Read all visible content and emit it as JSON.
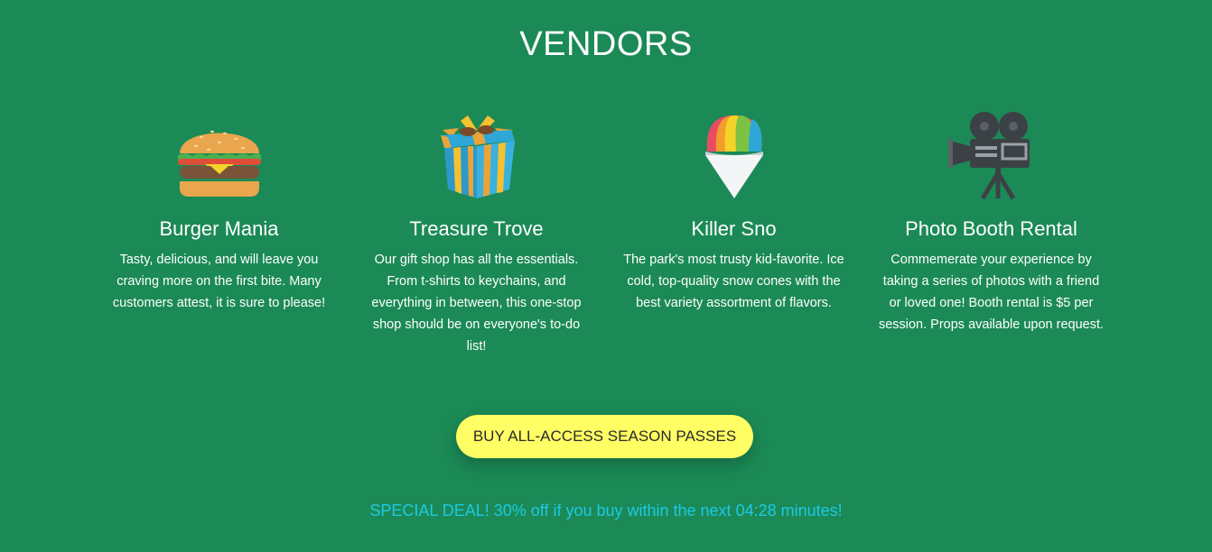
{
  "header": {
    "title": "VENDORS"
  },
  "vendors": [
    {
      "icon": "burger-icon",
      "name": "Burger Mania",
      "description": "Tasty, delicious, and will leave you craving more on the first bite. Many customers attest, it is sure to please!"
    },
    {
      "icon": "gift-box-icon",
      "name": "Treasure Trove",
      "description": "Our gift shop has all the essentials. From t-shirts to keychains, and everything in between, this one-stop shop should be on everyone's to-do list!"
    },
    {
      "icon": "snow-cone-icon",
      "name": "Killer Sno",
      "description": "The park's most trusty kid-favorite. Ice cold, top-quality snow cones with the best variety assortment of flavors."
    },
    {
      "icon": "movie-camera-icon",
      "name": "Photo Booth Rental",
      "description": "Commemerate your experience by taking a series of photos with a friend or loved one! Booth rental is $5 per session. Props available upon request."
    }
  ],
  "cta": {
    "label": "BUY ALL-ACCESS SEASON PASSES"
  },
  "deal": {
    "text": "SPECIAL DEAL! 30% off if you buy within the next 04:28 minutes!"
  },
  "colors": {
    "background": "#1b8a56",
    "button": "#fffe64",
    "deal_text": "#1ec8e6"
  }
}
